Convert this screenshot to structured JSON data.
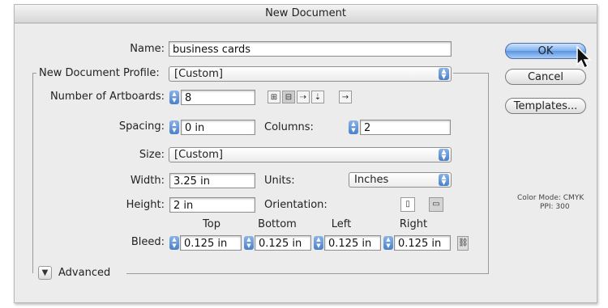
{
  "dialog": {
    "title": "New Document"
  },
  "name": {
    "label": "Name:",
    "value": "business cards"
  },
  "profile": {
    "label": "New Document Profile:",
    "value": "[Custom]"
  },
  "artboards": {
    "label": "Number of Artboards:",
    "value": "8",
    "spacing_label": "Spacing:",
    "spacing_value": "0 in",
    "columns_label": "Columns:",
    "columns_value": "2"
  },
  "size": {
    "label": "Size:",
    "value": "[Custom]"
  },
  "width": {
    "label": "Width:",
    "value": "3.25 in"
  },
  "units": {
    "label": "Units:",
    "value": "Inches"
  },
  "height": {
    "label": "Height:",
    "value": "2 in"
  },
  "orientation": {
    "label": "Orientation:"
  },
  "bleed": {
    "label": "Bleed:",
    "top_label": "Top",
    "bottom_label": "Bottom",
    "left_label": "Left",
    "right_label": "Right",
    "top": "0.125 in",
    "bottom": "0.125 in",
    "left": "0.125 in",
    "right": "0.125 in"
  },
  "advanced": {
    "label": "Advanced"
  },
  "buttons": {
    "ok": "OK",
    "cancel": "Cancel",
    "templates": "Templates..."
  },
  "info": {
    "color_mode": "Color Mode: CMYK",
    "ppi": "PPI: 300"
  },
  "icons": [
    "grid-by-row-icon",
    "grid-by-column-icon",
    "arrange-by-row-icon",
    "arrange-by-column-icon",
    "rtl-layout-icon",
    "portrait-icon",
    "landscape-icon",
    "link-icon",
    "disclosure-triangle-icon",
    "cursor-icon"
  ],
  "colors": {
    "accent": "#5a95e2",
    "dialog_bg": "#ececec"
  }
}
